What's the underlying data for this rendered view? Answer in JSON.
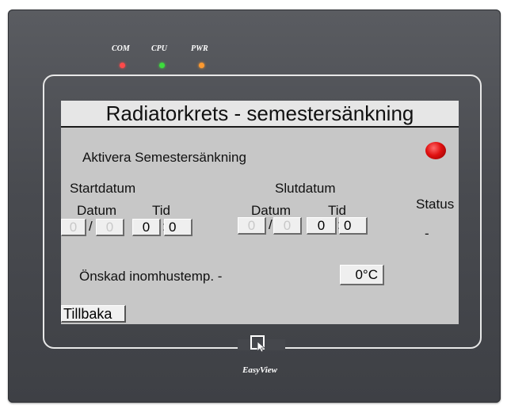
{
  "device": {
    "leds": [
      {
        "label": "COM",
        "color": "#ff4a4a"
      },
      {
        "label": "CPU",
        "color": "#3ddc3d"
      },
      {
        "label": "PWR",
        "color": "#ff9a30"
      }
    ],
    "brand": "EasyView"
  },
  "screen": {
    "title": "Radiatorkrets - semestersänkning",
    "activate_label": "Aktivera Semestersänkning",
    "start": {
      "heading": "Startdatum",
      "date_label": "Datum",
      "time_label": "Tid",
      "day": "0",
      "month": "0",
      "hour": "0",
      "minute": "0"
    },
    "end": {
      "heading": "Slutdatum",
      "date_label": "Datum",
      "time_label": "Tid",
      "day": "0",
      "month": "0",
      "hour": "0",
      "minute": "0"
    },
    "date_sep": "/",
    "time_sep": ":",
    "status_label": "Status",
    "status_value": "-",
    "temp_label": "Önskad inomhustemp. -",
    "temp_value": "0°C",
    "back_button": "Tillbaka"
  }
}
